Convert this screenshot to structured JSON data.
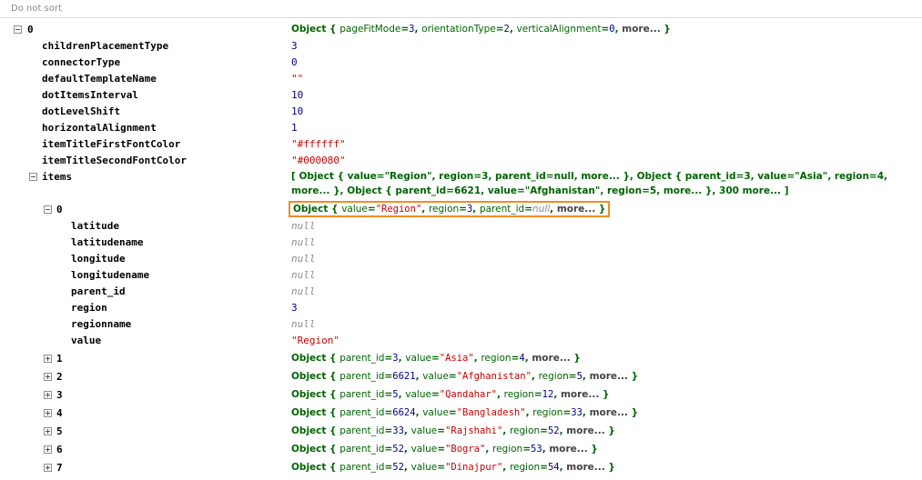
{
  "toolbar": {
    "sort_label": "Do not sort"
  },
  "tree": {
    "root": {
      "key": "0",
      "summary": {
        "fields": [
          {
            "k": "pageFitMode",
            "v": "3",
            "t": "n"
          },
          {
            "k": "orientationType",
            "v": "2",
            "t": "n"
          },
          {
            "k": "verticalAlignment",
            "v": "0",
            "t": "n"
          }
        ],
        "more": "more..."
      }
    },
    "props": [
      {
        "key": "childrenPlacementType",
        "value": "3",
        "type": "num"
      },
      {
        "key": "connectorType",
        "value": "0",
        "type": "num"
      },
      {
        "key": "defaultTemplateName",
        "value": "\"\"",
        "type": "str"
      },
      {
        "key": "dotItemsInterval",
        "value": "10",
        "type": "num"
      },
      {
        "key": "dotLevelShift",
        "value": "10",
        "type": "num"
      },
      {
        "key": "horizontalAlignment",
        "value": "1",
        "type": "num"
      },
      {
        "key": "itemTitleFirstFontColor",
        "value": "\"#ffffff\"",
        "type": "str"
      },
      {
        "key": "itemTitleSecondFontColor",
        "value": "\"#000080\"",
        "type": "str"
      }
    ],
    "items": {
      "key": "items",
      "line1": "[ Object { value=\"Region\", region=3, parent_id=null, more... }, Object { parent_id=3, value=\"Asia\", region=4,",
      "line2": "more... }, Object { parent_id=6621, value=\"Afghanistan\", region=5, more... }, 300 more... ]"
    },
    "item0": {
      "key": "0",
      "summary": {
        "fields": [
          {
            "k": "value",
            "v": "\"Region\"",
            "t": "s"
          },
          {
            "k": "region",
            "v": "3",
            "t": "n"
          },
          {
            "k": "parent_id",
            "v": "null",
            "t": "z"
          }
        ],
        "more": "more..."
      },
      "props": [
        {
          "key": "latitude",
          "value": "null",
          "type": "nul"
        },
        {
          "key": "latitudename",
          "value": "null",
          "type": "nul"
        },
        {
          "key": "longitude",
          "value": "null",
          "type": "nul"
        },
        {
          "key": "longitudename",
          "value": "null",
          "type": "nul"
        },
        {
          "key": "parent_id",
          "value": "null",
          "type": "nul"
        },
        {
          "key": "region",
          "value": "3",
          "type": "num"
        },
        {
          "key": "regionname",
          "value": "null",
          "type": "nul"
        },
        {
          "key": "value",
          "value": "\"Region\"",
          "type": "str"
        }
      ]
    },
    "collapsed_items": [
      {
        "key": "1",
        "fields": [
          {
            "k": "parent_id",
            "v": "3",
            "t": "n"
          },
          {
            "k": "value",
            "v": "\"Asia\"",
            "t": "s"
          },
          {
            "k": "region",
            "v": "4",
            "t": "n"
          }
        ],
        "more": "more..."
      },
      {
        "key": "2",
        "fields": [
          {
            "k": "parent_id",
            "v": "6621",
            "t": "n"
          },
          {
            "k": "value",
            "v": "\"Afghanistan\"",
            "t": "s"
          },
          {
            "k": "region",
            "v": "5",
            "t": "n"
          }
        ],
        "more": "more..."
      },
      {
        "key": "3",
        "fields": [
          {
            "k": "parent_id",
            "v": "5",
            "t": "n"
          },
          {
            "k": "value",
            "v": "\"Qandahar\"",
            "t": "s"
          },
          {
            "k": "region",
            "v": "12",
            "t": "n"
          }
        ],
        "more": "more..."
      },
      {
        "key": "4",
        "fields": [
          {
            "k": "parent_id",
            "v": "6624",
            "t": "n"
          },
          {
            "k": "value",
            "v": "\"Bangladesh\"",
            "t": "s"
          },
          {
            "k": "region",
            "v": "33",
            "t": "n"
          }
        ],
        "more": "more..."
      },
      {
        "key": "5",
        "fields": [
          {
            "k": "parent_id",
            "v": "33",
            "t": "n"
          },
          {
            "k": "value",
            "v": "\"Rajshahi\"",
            "t": "s"
          },
          {
            "k": "region",
            "v": "52",
            "t": "n"
          }
        ],
        "more": "more..."
      },
      {
        "key": "6",
        "fields": [
          {
            "k": "parent_id",
            "v": "52",
            "t": "n"
          },
          {
            "k": "value",
            "v": "\"Bogra\"",
            "t": "s"
          },
          {
            "k": "region",
            "v": "53",
            "t": "n"
          }
        ],
        "more": "more..."
      },
      {
        "key": "7",
        "fields": [
          {
            "k": "parent_id",
            "v": "52",
            "t": "n"
          },
          {
            "k": "value",
            "v": "\"Dinajpur\"",
            "t": "s"
          },
          {
            "k": "region",
            "v": "54",
            "t": "n"
          }
        ],
        "more": "more..."
      }
    ],
    "colors": {
      "highlight": "#f08c24",
      "object": "#006400",
      "number": "#000088",
      "string": "#cc0000",
      "null": "#8c8c8c"
    }
  }
}
